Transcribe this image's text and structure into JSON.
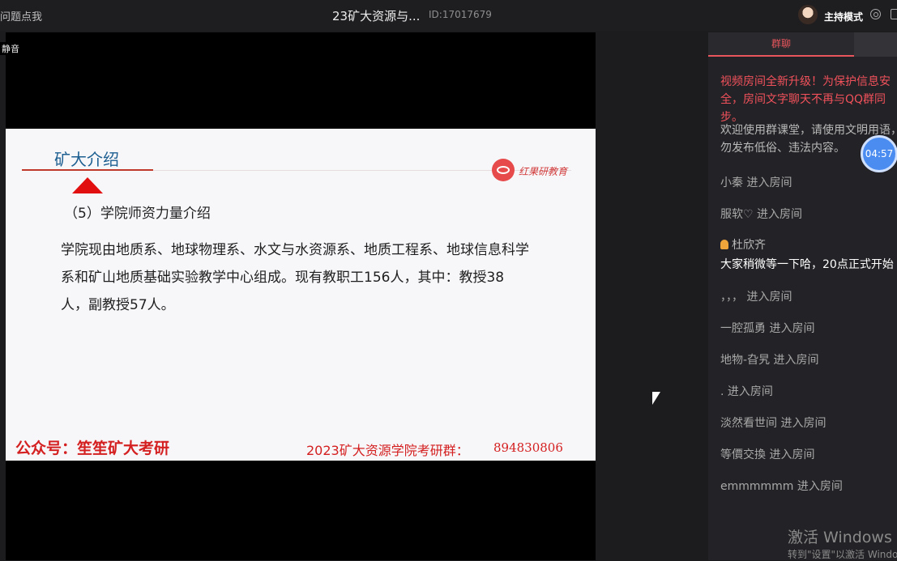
{
  "topbar": {
    "left_text": "问题点我",
    "title": "23矿大资源与...",
    "room_id": "ID:17017679",
    "mode_label": "主持模式"
  },
  "stream": {
    "tag": "静音"
  },
  "slide": {
    "title": "矿大介绍",
    "logo_text": "红果研教育",
    "section": "（5）学院师资力量介绍",
    "body": "学院现由地质系、地球物理系、水文与水资源系、地质工程系、地球信息科学系和矿山地质基础实验教学中心组成。现有教职工156人，其中：教授38人，副教授57人。",
    "footer_left": "公众号：笙笙矿大考研",
    "footer_right": "2023矿大资源学院考研群：",
    "footer_number": "894830806"
  },
  "panel": {
    "tab_group": "群聊",
    "notice": "视频房间全新升级！为保护信息安全，房间文字聊天不再与QQ群同步。",
    "welcome": "欢迎使用群课堂，请使用文明用语，勿发布低俗、违法内容。",
    "timer": "04:57",
    "host_name": "杜欣齐",
    "host_message": "大家稍微等一下哈，20点正式开始",
    "messages": [
      "小秦 进入房间",
      "服软♡ 进入房间",
      "，，， 进入房间",
      "一腔孤勇 进入房间",
      "地物-旮旯 进入房间",
      ". 进入房间",
      "淡然看世间 进入房间",
      "等價交換 进入房间",
      "emmmmmm 进入房间"
    ]
  },
  "watermark": {
    "line1": "激活 Windows",
    "line2": "转到\"设置\"以激活 Windows。"
  }
}
